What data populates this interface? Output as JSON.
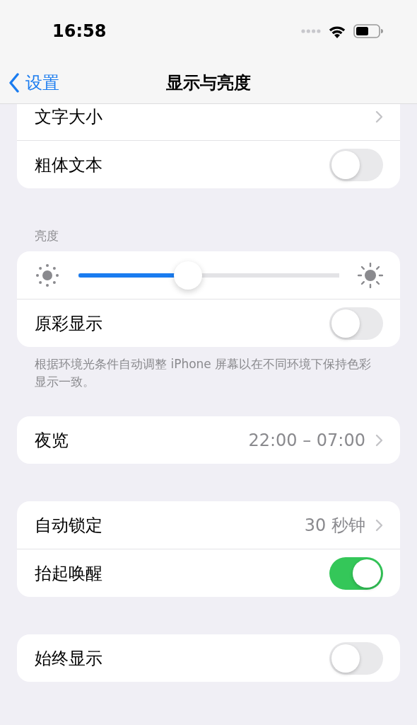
{
  "status_bar": {
    "time": "16:58"
  },
  "nav": {
    "back": "设置",
    "title": "显示与亮度"
  },
  "groups": [
    {
      "rows": [
        {
          "kind": "link",
          "label": "文字大小"
        },
        {
          "kind": "toggle",
          "label": "粗体文本",
          "on": false
        }
      ]
    },
    {
      "header": "亮度",
      "footer": "根据环境光条件自动调整 iPhone 屏幕以在不同环境下保持色彩显示一致。",
      "rows": [
        {
          "kind": "slider",
          "level": 0.42
        },
        {
          "kind": "toggle",
          "label": "原彩显示",
          "on": false
        }
      ]
    },
    {
      "rows": [
        {
          "kind": "link",
          "label": "夜览",
          "value": "22:00 – 07:00"
        }
      ]
    },
    {
      "rows": [
        {
          "kind": "link",
          "label": "自动锁定",
          "value": "30 秒钟"
        },
        {
          "kind": "toggle",
          "label": "抬起唤醒",
          "on": true
        }
      ]
    },
    {
      "rows": [
        {
          "kind": "toggle",
          "label": "始终显示",
          "on": false
        }
      ]
    }
  ]
}
